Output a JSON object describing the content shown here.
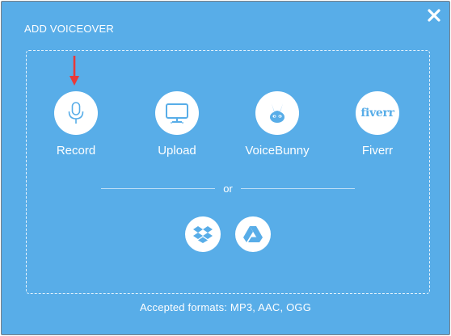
{
  "dialog": {
    "title": "ADD VOICEOVER",
    "options": [
      {
        "label": "Record",
        "icon": "microphone-icon"
      },
      {
        "label": "Upload",
        "icon": "monitor-icon"
      },
      {
        "label": "VoiceBunny",
        "icon": "bunny-icon"
      },
      {
        "label": "Fiverr",
        "icon": "fiverr-logo-icon",
        "logo_text": "fiverr"
      }
    ],
    "divider_text": "or",
    "cloud_sources": [
      {
        "icon": "dropbox-icon"
      },
      {
        "icon": "google-drive-icon"
      }
    ],
    "accepted_formats": "Accepted formats: MP3, AAC, OGG"
  },
  "colors": {
    "background": "#58ade8",
    "icon_blue": "#58ade8",
    "annotation_arrow": "#e83a3a"
  }
}
